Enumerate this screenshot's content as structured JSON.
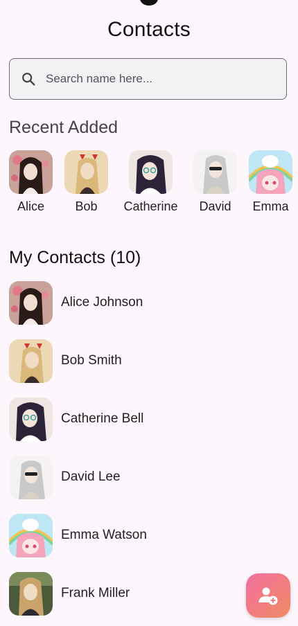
{
  "header": {
    "title": "Contacts"
  },
  "search": {
    "placeholder": "Search name here..."
  },
  "recent": {
    "heading": "Recent Added",
    "items": [
      {
        "label": "Alice",
        "avatar": "alice"
      },
      {
        "label": "Bob",
        "avatar": "bob"
      },
      {
        "label": "Catherine",
        "avatar": "catherine"
      },
      {
        "label": "David",
        "avatar": "david"
      },
      {
        "label": "Emma",
        "avatar": "emma"
      }
    ]
  },
  "contacts": {
    "heading": "My Contacts (10)",
    "items": [
      {
        "name": "Alice Johnson",
        "avatar": "alice"
      },
      {
        "name": "Bob Smith",
        "avatar": "bob"
      },
      {
        "name": "Catherine Bell",
        "avatar": "catherine"
      },
      {
        "name": "David Lee",
        "avatar": "david"
      },
      {
        "name": "Emma Watson",
        "avatar": "emma"
      },
      {
        "name": "Frank Miller",
        "avatar": "frank"
      }
    ]
  },
  "fab": {
    "icon": "add-person-icon"
  },
  "colors": {
    "background": "#fdf6fd",
    "fab_gradient_start": "#f36fa0",
    "fab_gradient_end": "#f08a62"
  }
}
